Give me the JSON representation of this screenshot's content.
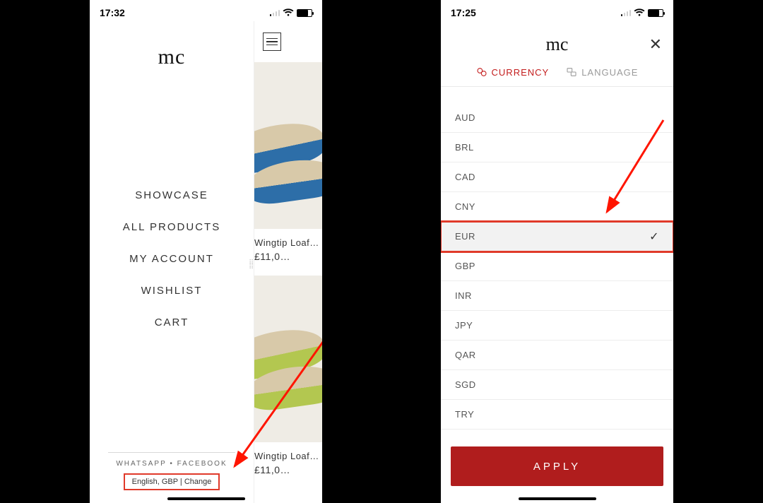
{
  "left": {
    "status": {
      "time": "17:32"
    },
    "brand": "mc",
    "menu": [
      "SHOWCASE",
      "ALL PRODUCTS",
      "MY ACCOUNT",
      "WISHLIST",
      "CART"
    ],
    "social": "WHATSAPP  •  FACEBOOK",
    "locale_line": "English, GBP | Change",
    "products": [
      {
        "title": "Wingtip Loaf…",
        "price": "£11,0…"
      },
      {
        "title": "Wingtip Loaf…",
        "price": "£11,0…"
      }
    ]
  },
  "right": {
    "status": {
      "time": "17:25"
    },
    "brand": "mc",
    "tabs": {
      "currency": "CURRENCY",
      "language": "LANGUAGE"
    },
    "currencies": [
      "AUD",
      "BRL",
      "CAD",
      "CNY",
      "EUR",
      "GBP",
      "INR",
      "JPY",
      "QAR",
      "SGD",
      "TRY"
    ],
    "selected": "EUR",
    "apply": "APPLY"
  }
}
